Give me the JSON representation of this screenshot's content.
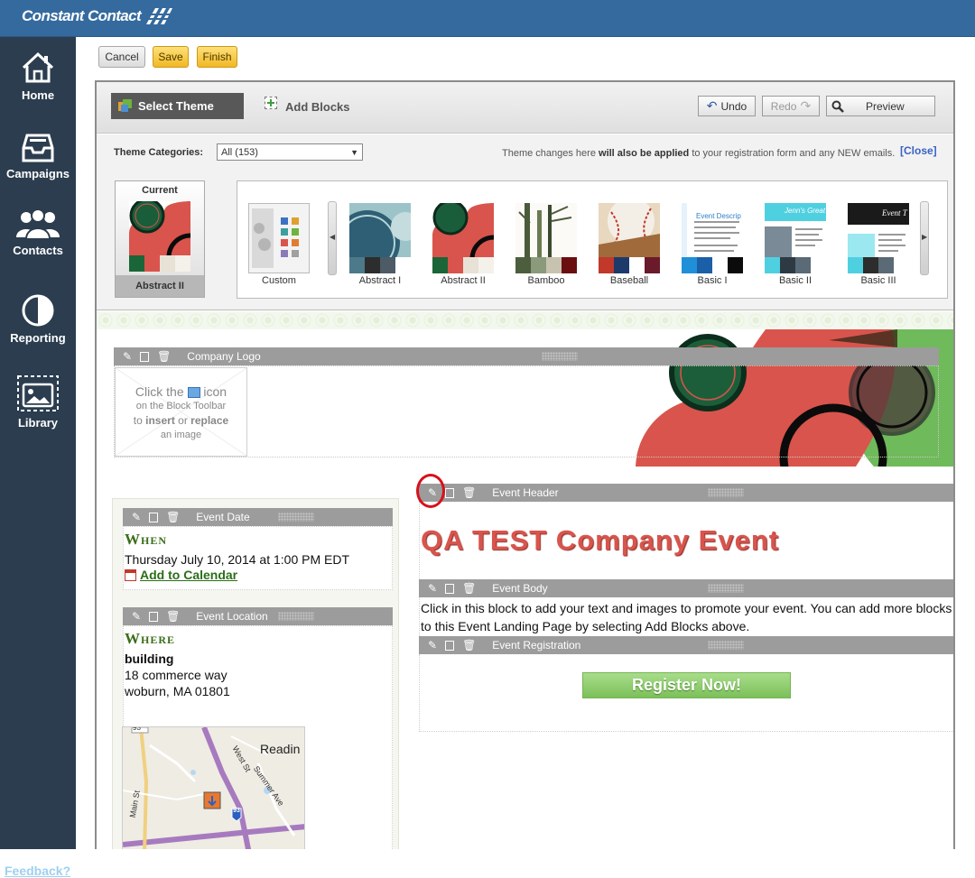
{
  "brand": {
    "name": "Constant Contact"
  },
  "sidebar": {
    "items": [
      {
        "label": "Home",
        "icon": "home-icon"
      },
      {
        "label": "Campaigns",
        "icon": "inbox-icon"
      },
      {
        "label": "Contacts",
        "icon": "people-icon"
      },
      {
        "label": "Reporting",
        "icon": "pie-chart-icon"
      },
      {
        "label": "Library",
        "icon": "image-icon"
      }
    ],
    "feedback": "Feedback?"
  },
  "actions": {
    "cancel": "Cancel",
    "save": "Save",
    "finish": "Finish"
  },
  "toolbar": {
    "select_theme": "Select Theme",
    "add_blocks": "Add Blocks",
    "undo": "Undo",
    "redo": "Redo",
    "preview": "Preview"
  },
  "theme_panel": {
    "categories_label": "Theme Categories:",
    "categories_value": "All (153)",
    "note_pre": "Theme changes here ",
    "note_bold": "will also be applied",
    "note_post": " to your registration form and any NEW emails.",
    "close": "[Close]",
    "current_label": "Current",
    "current_name": "Abstract II",
    "themes": [
      "Custom",
      "Abstract I",
      "Abstract II",
      "Bamboo",
      "Baseball",
      "Basic I",
      "Basic II",
      "Basic III"
    ],
    "basic_thumb_texts": {
      "basic1": "Event Descrip",
      "basic2": "Jenn's Great",
      "basic3": "Event T"
    }
  },
  "canvas": {
    "logo_block": {
      "title": "Company Logo",
      "line1": "Click the",
      "line1_icon": "icon",
      "line2": "on the Block Toolbar",
      "line3_pre": "to ",
      "line3_insert": "insert",
      "line3_mid": " or ",
      "line3_replace": "replace",
      "line4": "an image"
    },
    "event_date": {
      "title": "Event Date",
      "heading": "When",
      "date": "Thursday July 10, 2014 at 1:00 PM EDT",
      "add_calendar": "Add to Calendar"
    },
    "event_location": {
      "title": "Event Location",
      "heading": "Where",
      "venue": "building",
      "street": "18 commerce way",
      "city": "woburn, MA 01801"
    },
    "map": {
      "label": "Readin",
      "street1": "West St",
      "street2": "Summer Ave",
      "street3": "Main St",
      "shield": "93",
      "shield2": "93"
    },
    "event_header": {
      "title": "Event Header",
      "text": "QA TEST Company Event"
    },
    "event_body": {
      "title": "Event Body",
      "text": "Click in this block to add your text and images to promote your event. You can add more blocks to this Event Landing Page by selecting Add Blocks above."
    },
    "event_registration": {
      "title": "Event Registration",
      "button": "Register Now!"
    }
  },
  "colors": {
    "topbar": "#356a9e",
    "sidebar": "#2b3d4f",
    "accent_red": "#d9544c",
    "accent_green": "#3a6e18",
    "register_green": "#8fcc6e"
  }
}
